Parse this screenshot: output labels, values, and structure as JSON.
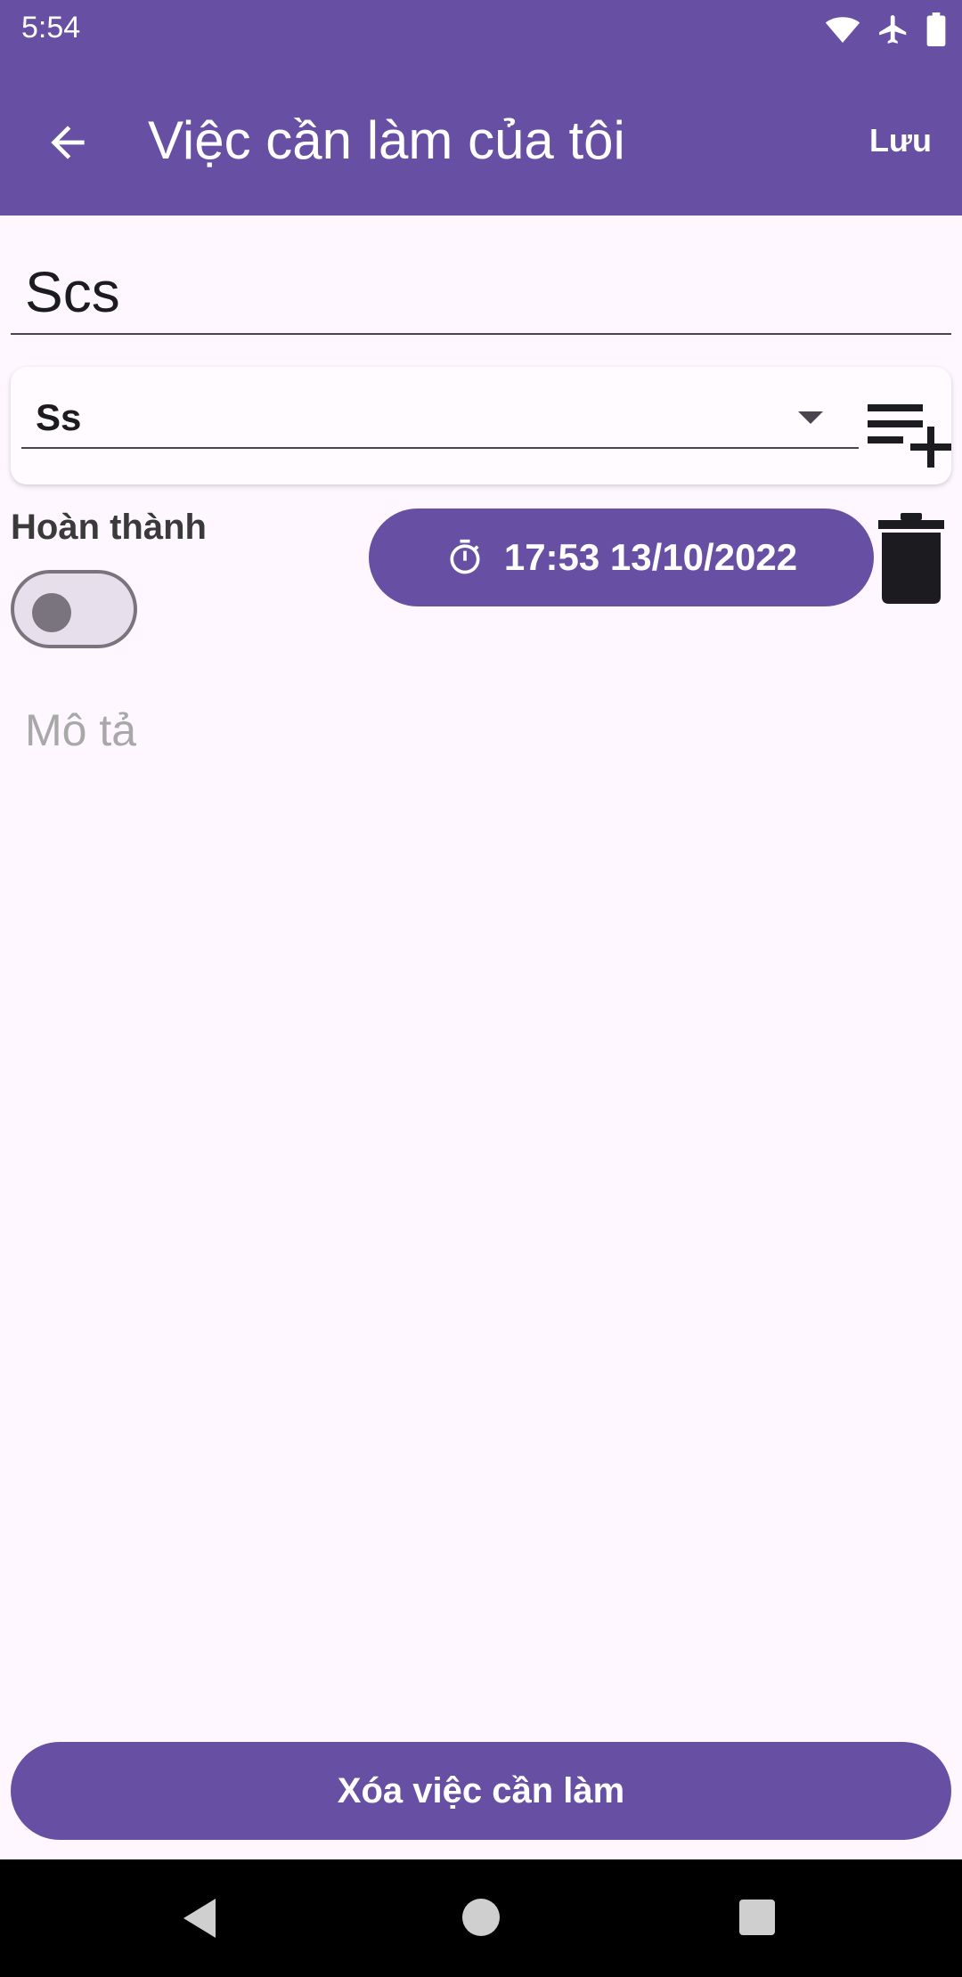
{
  "status_bar": {
    "time": "5:54",
    "icons": [
      "wifi-icon",
      "airplane-icon",
      "battery-icon"
    ]
  },
  "app_bar": {
    "back_icon": "arrow-back-icon",
    "title": "Việc cần làm của tôi",
    "save_label": "Lưu"
  },
  "form": {
    "title_value": "Scs",
    "category": {
      "selected": "Ss",
      "add_icon": "playlist-add-icon"
    },
    "done_label": "Hoàn thành",
    "done_checked": false,
    "datetime": {
      "icon": "timer-icon",
      "value": "17:53 13/10/2022"
    },
    "delete_icon": "trash-icon",
    "description_placeholder": "Mô tả"
  },
  "delete_button_label": "Xóa việc cần làm",
  "nav_bar": {
    "icons": [
      "nav-back-icon",
      "nav-home-icon",
      "nav-recents-icon"
    ]
  },
  "colors": {
    "primary": "#6750A4",
    "background": "#FEF7FF",
    "on_primary": "#FFFFFF"
  }
}
